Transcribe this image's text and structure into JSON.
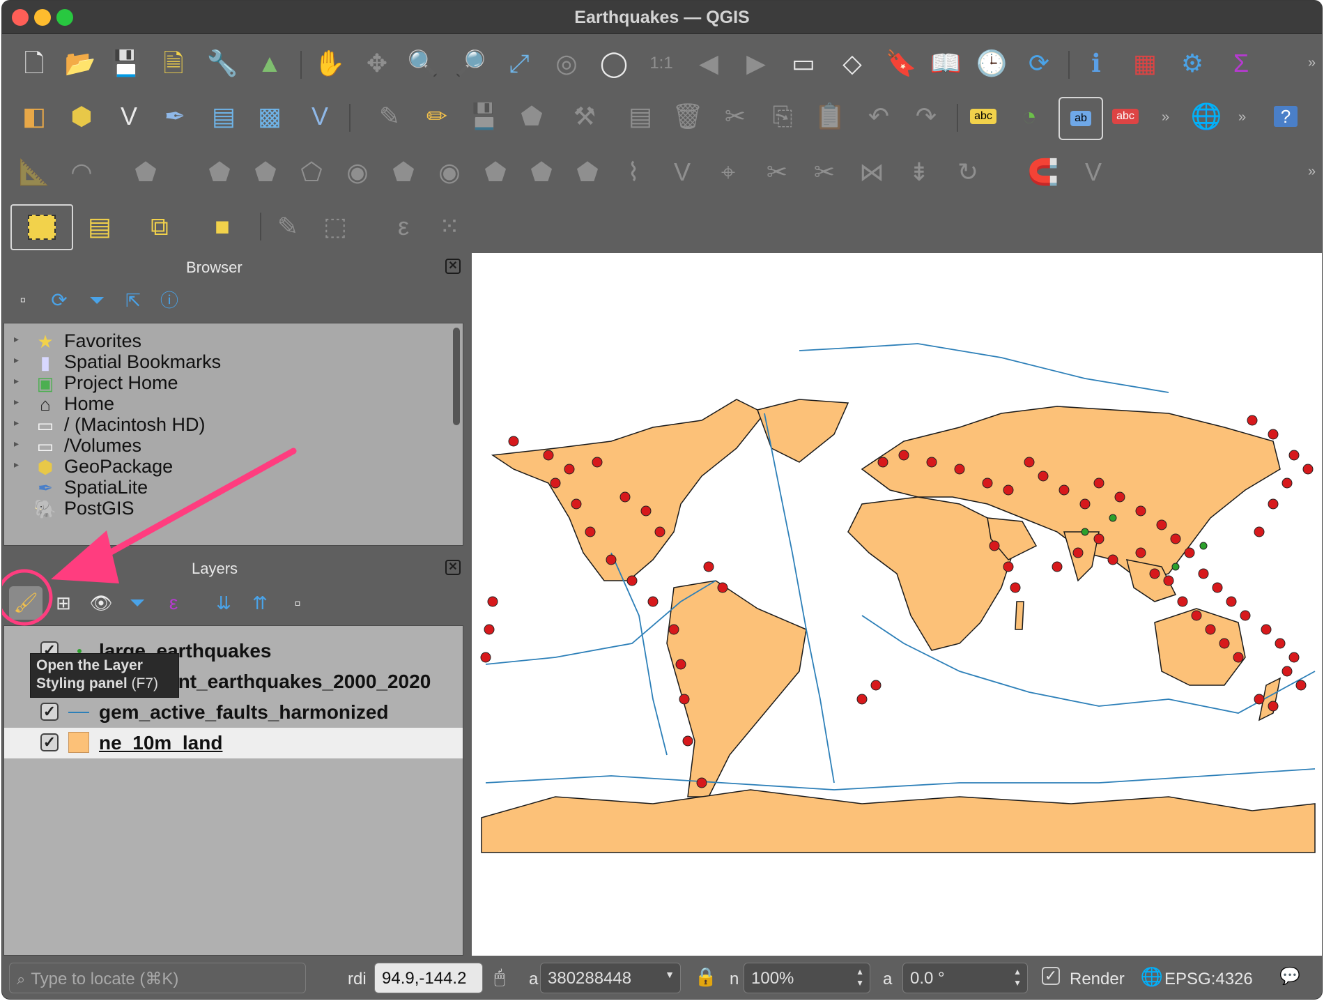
{
  "window": {
    "title": "Earthquakes — QGIS"
  },
  "panels": {
    "browser": {
      "title": "Browser",
      "items": [
        {
          "label": "Favorites",
          "icon": "star-icon"
        },
        {
          "label": "Spatial Bookmarks",
          "icon": "bookmark-icon"
        },
        {
          "label": "Project Home",
          "icon": "project-home-icon"
        },
        {
          "label": "Home",
          "icon": "home-icon"
        },
        {
          "label": "/ (Macintosh HD)",
          "icon": "folder-icon"
        },
        {
          "label": "/Volumes",
          "icon": "folder-icon"
        },
        {
          "label": "GeoPackage",
          "icon": "geopackage-icon"
        },
        {
          "label": "SpatiaLite",
          "icon": "spatialite-icon"
        },
        {
          "label": "PostGIS",
          "icon": "postgis-icon"
        }
      ]
    },
    "layers": {
      "title": "Layers",
      "items": [
        {
          "label": "large_earthquakes",
          "checked": true
        },
        {
          "label": "significant_earthquakes_2000_2020",
          "checked": true
        },
        {
          "label": "gem_active_faults_harmonized",
          "checked": true
        },
        {
          "label": "ne_10m_land",
          "checked": true
        }
      ]
    }
  },
  "tooltip": {
    "line1": "Open the Layer",
    "line2": "Styling panel",
    "shortcut": "(F7)"
  },
  "toolbar": {
    "snap_tolerance": "12"
  },
  "statusbar": {
    "locate_placeholder": "Type to locate (⌘K)",
    "coordinate_label": "rdi",
    "coordinate": "94.9,-144.2",
    "scale_label": "a",
    "scale": "380288448",
    "magnifier_label": "n",
    "magnifier": "100%",
    "rotation_label": "a",
    "rotation": "0.0 °",
    "render_label": "Render",
    "crs": "EPSG:4326"
  },
  "colors": {
    "land": "#fcc178",
    "faults": "#2c7fb8",
    "quake_large": "#2ca02c",
    "quake_significant": "#d7191c",
    "highlight": "#ff3d7f"
  }
}
